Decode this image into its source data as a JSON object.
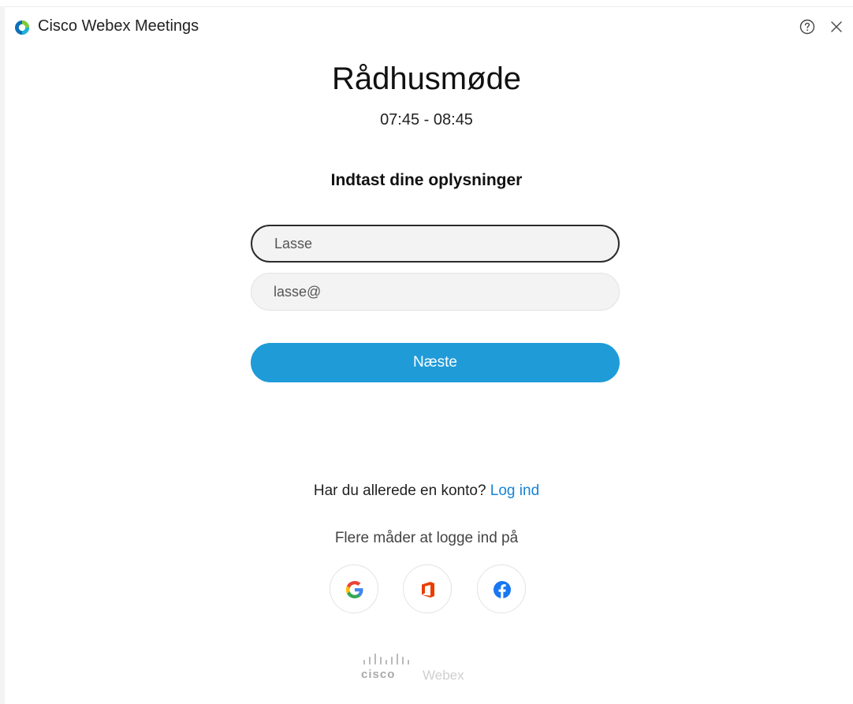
{
  "window": {
    "title": "Cisco Webex Meetings",
    "help_icon": "help-circle-icon",
    "close_icon": "close-icon"
  },
  "meeting": {
    "title": "Rådhusmøde",
    "time": "07:45 - 08:45"
  },
  "form": {
    "heading": "Indtast dine oplysninger",
    "name_value": "Lasse",
    "email_value": "lasse@",
    "next_label": "Næste"
  },
  "account": {
    "prompt": "Har du allerede en konto? ",
    "login_link": "Log ind",
    "more_ways": "Flere måder at logge ind på"
  },
  "sso": [
    {
      "name": "google-icon",
      "label": "G"
    },
    {
      "name": "office-icon"
    },
    {
      "name": "facebook-icon"
    }
  ],
  "footer": {
    "cisco": "cisco",
    "webex": "Webex"
  },
  "colors": {
    "accent": "#1f9bd8",
    "link": "#1584d6"
  }
}
